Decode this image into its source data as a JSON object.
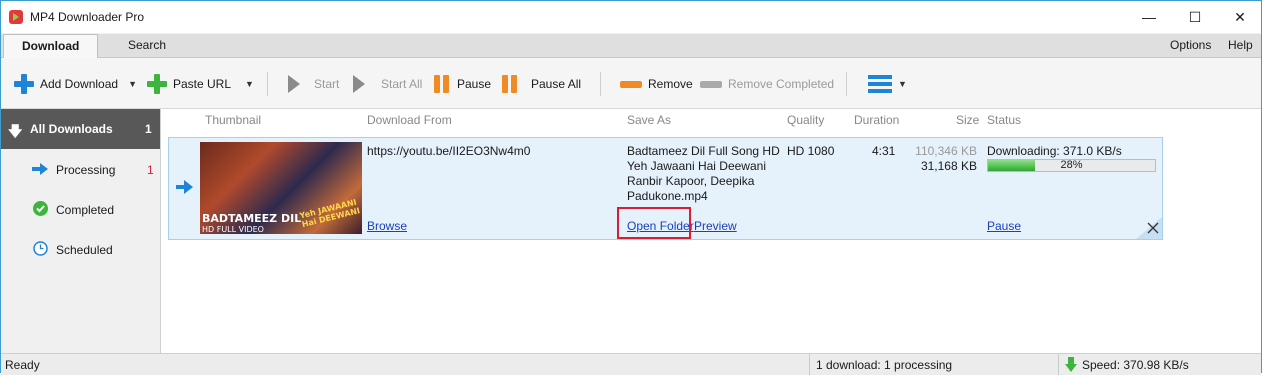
{
  "window": {
    "title": "MP4 Downloader Pro",
    "minimize_glyph": "—",
    "maximize_glyph": "☐",
    "close_glyph": "✕"
  },
  "menu": {
    "tabs": [
      "Download",
      "Search"
    ],
    "right": [
      "Options",
      "Help"
    ]
  },
  "toolbar": {
    "add_download": "Add Download",
    "paste_url": "Paste URL",
    "start": "Start",
    "start_all": "Start All",
    "pause": "Pause",
    "pause_all": "Pause All",
    "remove": "Remove",
    "remove_completed": "Remove Completed",
    "caret": "▼"
  },
  "sidebar": {
    "header_label": "All Downloads",
    "header_count": "1",
    "items": [
      {
        "label": "Processing",
        "count": "1"
      },
      {
        "label": "Completed",
        "count": ""
      },
      {
        "label": "Scheduled",
        "count": ""
      }
    ]
  },
  "columns": {
    "thumbnail": "Thumbnail",
    "download_from": "Download From",
    "save_as": "Save As",
    "quality": "Quality",
    "duration": "Duration",
    "size": "Size",
    "status": "Status"
  },
  "download": {
    "url": "https://youtu.be/II2EO3Nw4m0",
    "save_as_lines": [
      "Badtameez Dil Full Song HD",
      "Yeh Jawaani Hai Deewani",
      "Ranbir Kapoor, Deepika",
      "Padukone.mp4"
    ],
    "quality": "HD 1080",
    "duration": "4:31",
    "size_total": "110,346 KB",
    "size_done": "31,168 KB",
    "status_text": "Downloading: 371.0 KB/s",
    "progress_percent": 28,
    "progress_label": "28%",
    "browse": "Browse",
    "open_folder": "Open Folder",
    "preview": "Preview",
    "pause": "Pause",
    "thumb_title": "BADTAMEEZ DIL",
    "thumb_sub": "HD FULL VIDEO",
    "thumb_logo": "Yeh JAWAANI Hai DEEWANI"
  },
  "statusbar": {
    "left": "Ready",
    "middle": "1 download: 1 processing",
    "speed": "Speed: 370.98 KB/s"
  },
  "colors": {
    "accent_blue": "#1d84d8",
    "green": "#3db43d",
    "orange": "#f08a24",
    "highlight_red": "#d71e37"
  }
}
